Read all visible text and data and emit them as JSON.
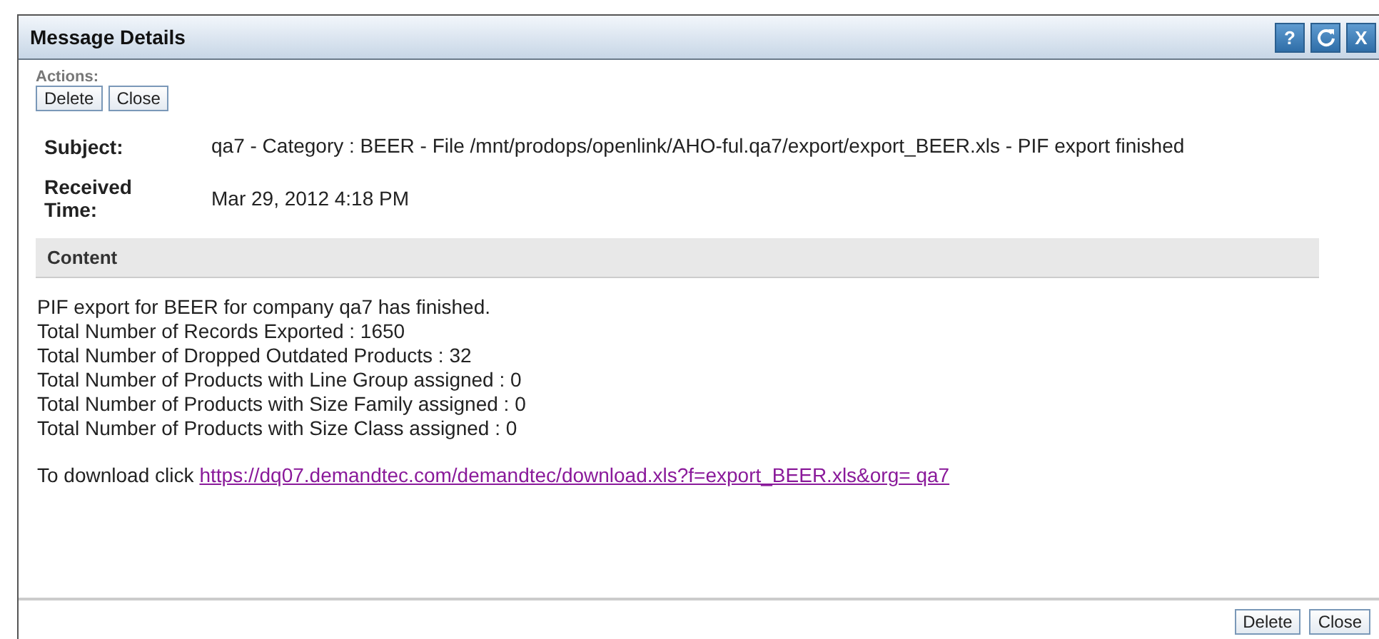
{
  "window": {
    "title": "Message Details",
    "title_buttons": [
      {
        "kind": "help",
        "label": "?"
      },
      {
        "kind": "refresh"
      },
      {
        "kind": "close",
        "label": "X"
      }
    ]
  },
  "actions": {
    "label": "Actions:",
    "buttons": [
      "Delete",
      "Close"
    ]
  },
  "fields": [
    {
      "label": "Subject:",
      "value": "qa7 - Category : BEER - File /mnt/prodops/openlink/AHO-ful.qa7/export/export_BEER.xls - PIF export finished"
    },
    {
      "label": "Received Time:",
      "value": "Mar 29, 2012 4:18 PM"
    }
  ],
  "content": {
    "heading": "Content",
    "lines": [
      "PIF export for BEER for company qa7 has finished.",
      "Total Number of Records Exported : 1650",
      "Total Number of Dropped Outdated Products : 32",
      "Total Number of Products with Line Group assigned : 0",
      "Total Number of Products with Size Family assigned : 0",
      "Total Number of Products with Size Class assigned : 0"
    ],
    "download_text": "To download click",
    "download_link": "https://dq07.demandtec.com/demandtec/download.xls?f=export_BEER.xls&org= qa7"
  },
  "footer_buttons": [
    "Delete",
    "Close"
  ]
}
